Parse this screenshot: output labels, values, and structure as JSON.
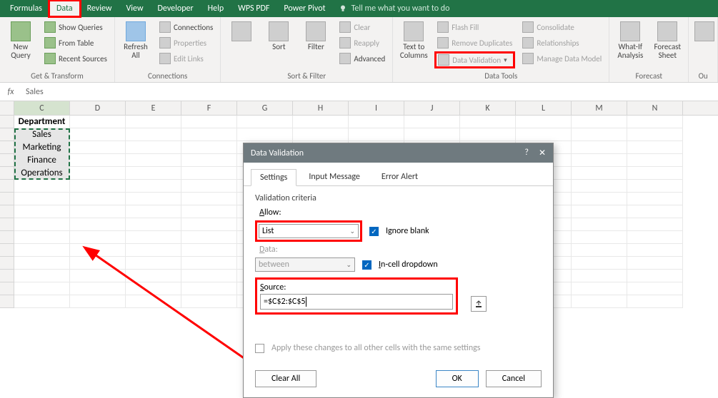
{
  "tabs": {
    "formulas": "Formulas",
    "data": "Data",
    "review": "Review",
    "view": "View",
    "developer": "Developer",
    "help": "Help",
    "wps": "WPS PDF",
    "powerpivot": "Power Pivot",
    "tellme": "Tell me what you want to do"
  },
  "ribbon": {
    "get_transform": {
      "new_query": "New\nQuery",
      "show_queries": "Show Queries",
      "from_table": "From Table",
      "recent_sources": "Recent Sources",
      "label": "Get & Transform"
    },
    "connections_grp": {
      "refresh": "Refresh\nAll",
      "connections": "Connections",
      "properties": "Properties",
      "edit_links": "Edit Links",
      "label": "Connections"
    },
    "sort_filter": {
      "sort": "Sort",
      "filter": "Filter",
      "clear": "Clear",
      "reapply": "Reapply",
      "advanced": "Advanced",
      "label": "Sort & Filter"
    },
    "data_tools": {
      "text_to_cols": "Text to\nColumns",
      "flash_fill": "Flash Fill",
      "remove_dup": "Remove Duplicates",
      "data_validation": "Data Validation",
      "consolidate": "Consolidate",
      "relationships": "Relationships",
      "manage_dm": "Manage Data Model",
      "label": "Data Tools"
    },
    "forecast": {
      "whatif": "What-If\nAnalysis",
      "forecast_sheet": "Forecast\nSheet",
      "label": "Forecast"
    },
    "outline": {
      "label": "Ou"
    }
  },
  "formula_bar": {
    "fx": "fx",
    "value": "Sales"
  },
  "columns": [
    "C",
    "D",
    "E",
    "F",
    "G",
    "H",
    "I",
    "J",
    "K",
    "L",
    "M",
    "N"
  ],
  "cells": {
    "header": "Department",
    "r2": "Sales",
    "r3": "Marketing",
    "r4": "Finance",
    "r5": "Operations"
  },
  "dialog": {
    "title": "Data Validation",
    "help": "?",
    "close": "✕",
    "tabs": {
      "settings": "Settings",
      "input": "Input Message",
      "error": "Error Alert"
    },
    "criteria": "Validation criteria",
    "allow_label": "Allow:",
    "allow_value": "List",
    "ignore_blank": "Ignore blank",
    "incell": "In-cell dropdown",
    "data_label": "Data:",
    "data_value": "between",
    "source_label": "Source:",
    "source_value": "=$C$2:$C$5",
    "apply_same": "Apply these changes to all other cells with the same settings",
    "clear_all": "Clear All",
    "ok": "OK",
    "cancel": "Cancel"
  }
}
